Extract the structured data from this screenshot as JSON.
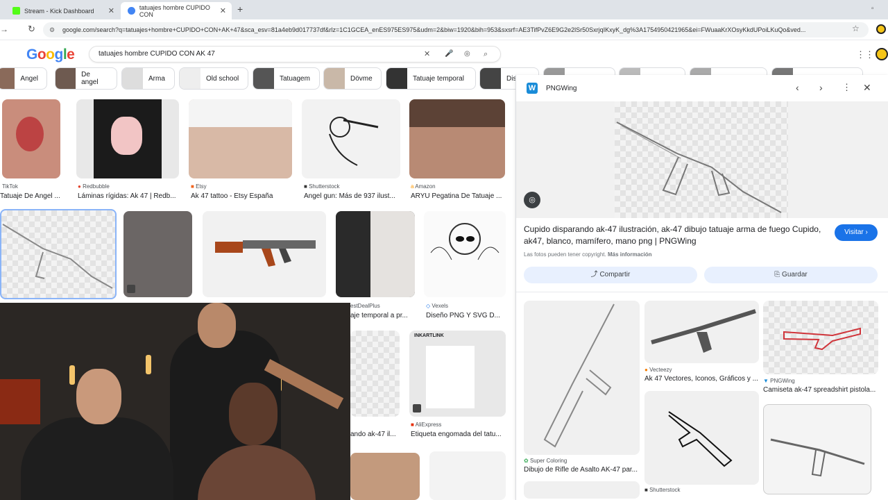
{
  "browser": {
    "tabs": [
      {
        "title": "Stream - Kick Dashboard",
        "favicon_color": "#53fc18",
        "active": false
      },
      {
        "title": "tatuajes hombre CUPIDO CON",
        "favicon_color": "#4285f4",
        "active": true
      }
    ],
    "new_tab": "+",
    "url": "google.com/search?q=tatuajes+hombre+CUPIDO+CON+AK+47&sca_esv=81a4eb9d017737df&rlz=1C1GCEA_enES975ES975&udm=2&biw=1920&bih=953&sxsrf=AE3TifPvZ6E9G2e2lSr50SxrjqIKxyK_dg%3A1754950421965&ei=FWuaaKrXOsyKkdUPoiLKuQo&ved..."
  },
  "google": {
    "logo": "Google",
    "query": "tatuajes hombre CUPIDO CON AK 47"
  },
  "chips": [
    "Angel",
    "De angel",
    "Arma",
    "Old school",
    "Tatuagem",
    "Dövme",
    "Tatuaje temporal",
    "Dis"
  ],
  "results_row1": [
    {
      "source": "TikTok",
      "title": "Tatuaje De Angel ..."
    },
    {
      "source": "Redbubble",
      "title": "Láminas rígidas: Ak 47 | Redb..."
    },
    {
      "source": "Etsy",
      "title": "Ak 47 tattoo - Etsy España"
    },
    {
      "source": "Shutterstock",
      "title": "Angel gun: Más de 937 ilust..."
    },
    {
      "source": "Amazon",
      "title": "ARYU Pegatina De Tatuaje ..."
    }
  ],
  "results_row2": [
    {
      "source": "estDealPlus",
      "title": "aje temporal a pr..."
    },
    {
      "source": "Vexels",
      "title": "Diseño PNG Y SVG D..."
    }
  ],
  "results_row3": [
    {
      "source": "",
      "title": "ando ak-47 il..."
    },
    {
      "source": "AliExpress",
      "title": "Etiqueta engomada del tatu..."
    }
  ],
  "inkartlink": "INKARTLINK",
  "panel": {
    "site": "PNGWing",
    "title": "Cupido disparando ak-47 ilustración, ak-47 dibujo tatuaje arma de fuego Cupido, ak47, blanco, mamífero, mano png | PNGWing",
    "copyright": "Las fotos pueden tener copyright.",
    "more_info": "Más información",
    "visit": "Visitar",
    "share": "Compartir",
    "save": "Guardar",
    "related": [
      {
        "source": "Super Coloring",
        "title": "Dibujo de Rifle de Asalto AK-47 par..."
      },
      {
        "source": "Vecteezy",
        "title": "Ak 47 Vectores, Iconos, Gráficos y ..."
      },
      {
        "source": "PNGWing",
        "title": "Camiseta ak-47 spreadshirt pistola..."
      },
      {
        "source": "Shutterstock",
        "title": ""
      }
    ]
  },
  "colors": {
    "accent": "#1a73e8",
    "tab_bg": "#dfe3e8",
    "button_bg": "#e8f0fe"
  }
}
